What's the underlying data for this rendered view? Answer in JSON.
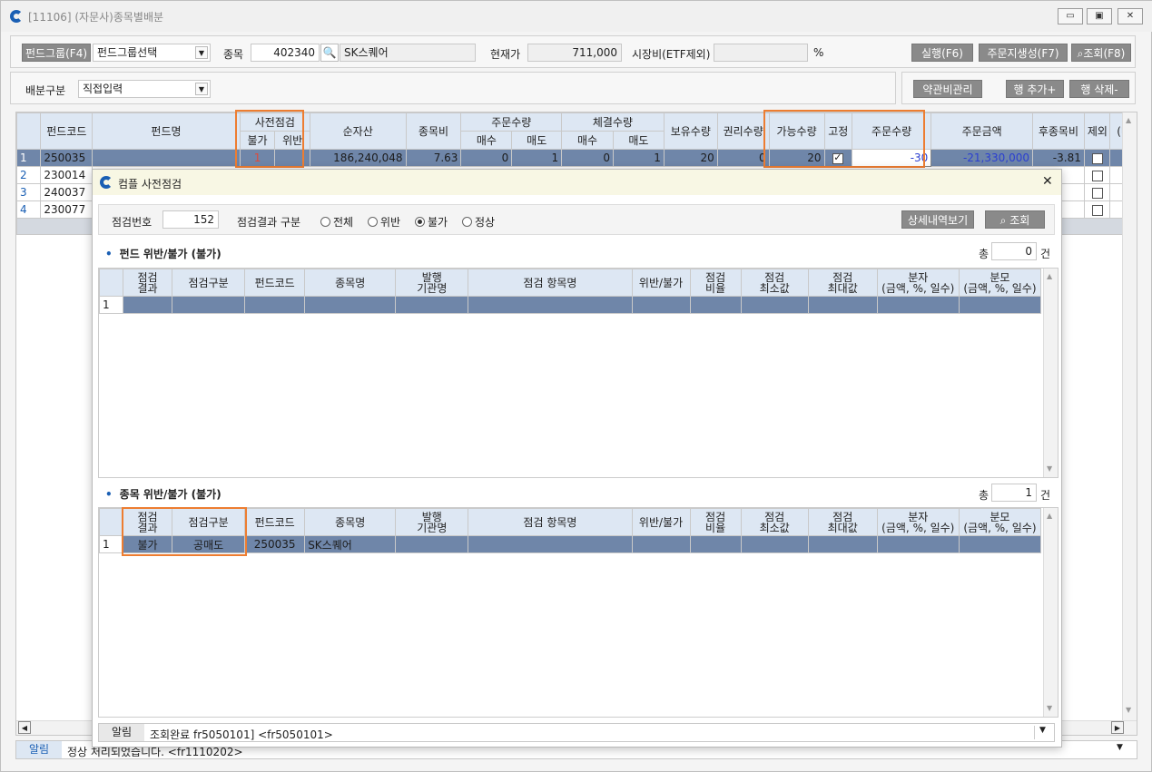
{
  "window": {
    "title": "[11106] (자문사)종목별배분",
    "btn_min": "▭",
    "btn_max": "▣",
    "btn_close": "✕"
  },
  "toolbar": {
    "fund_group_btn": "펀드그룹(F4)",
    "fund_group_select": "펀드그룹선택",
    "stock_label": "종목",
    "stock_code": "402340",
    "stock_name": "SK스퀘어",
    "price_label": "현재가",
    "price_value": "711,000",
    "mkt_ratio_label": "시장비(ETF제외)",
    "mkt_ratio_value": "",
    "pct": "%",
    "run_btn": "실행(F6)",
    "order_gen_btn": "주문지생성(F7)",
    "search_btn": "조회(F8)",
    "alloc_label": "배분구분",
    "alloc_select": "직접입력",
    "fee_btn": "약관비관리",
    "row_add_btn": "행 추가+",
    "row_del_btn": "행 삭제-"
  },
  "main_grid": {
    "headers": {
      "fund_code": "펀드코드",
      "fund_name": "펀드명",
      "precheck": "사전점검",
      "precheck_no": "불가",
      "precheck_viol": "위반",
      "net_asset": "순자산",
      "stock_ratio": "종목비",
      "order_qty": "주문수량",
      "buy": "매수",
      "sell": "매도",
      "exec_qty": "체결수량",
      "exec_buy": "매수",
      "exec_sell": "매도",
      "hold_qty": "보유수량",
      "right_qty": "권리수량",
      "avail_qty": "가능수량",
      "fixed": "고정",
      "ord_qty2": "주문수량",
      "ord_amt": "주문금액",
      "after_ratio": "후종목비",
      "exclude": "제외",
      "extra": "(매"
    },
    "rows": [
      {
        "n": "1",
        "code": "250035",
        "name": "",
        "no": "1",
        "viol": "",
        "asset": "186,240,048",
        "ratio": "7.63",
        "buy": "0",
        "sell": "1",
        "ebuy": "0",
        "esell": "1",
        "hold": "20",
        "right": "0",
        "avail": "20",
        "fixed": true,
        "qty": "-30",
        "amt": "-21,330,000",
        "after": "-3.81"
      },
      {
        "n": "2",
        "code": "230014"
      },
      {
        "n": "3",
        "code": "240037"
      },
      {
        "n": "4",
        "code": "230077"
      }
    ]
  },
  "dialog": {
    "title": "컴플 사전점검",
    "close": "✕",
    "check_no_label": "점검번호",
    "check_no": "152",
    "result_label": "점검결과 구분",
    "radios": [
      "전체",
      "위반",
      "불가",
      "정상"
    ],
    "detail_btn": "상세내역보기",
    "search_btn": "조회",
    "fund_section": "펀드 위반/불가 (불가)",
    "stock_section": "종목  위반/불가 (불가)",
    "total_label": "총",
    "count_unit": "건",
    "fund_total": "0",
    "stock_total": "1",
    "grid_headers": [
      "점검\n결과",
      "점검구분",
      "펀드코드",
      "종목명",
      "발행\n기관명",
      "점검 항목명",
      "위반/불가",
      "점검\n비율",
      "점검\n최소값",
      "점검\n최대값",
      "분자\n(금액, %, 일수)",
      "분모\n(금액, %, 일수)"
    ],
    "fund_rows": [
      {
        "n": "1"
      }
    ],
    "stock_rows": [
      {
        "n": "1",
        "result": "불가",
        "type": "공매도",
        "code": "250035",
        "name": "SK스퀘어"
      }
    ],
    "alert_label": "알림",
    "alert_msg": "조회완료 fr5050101] <fr5050101>"
  },
  "status": {
    "label": "알림",
    "msg": "정상 처리되었습니다. <fr1110202>"
  }
}
